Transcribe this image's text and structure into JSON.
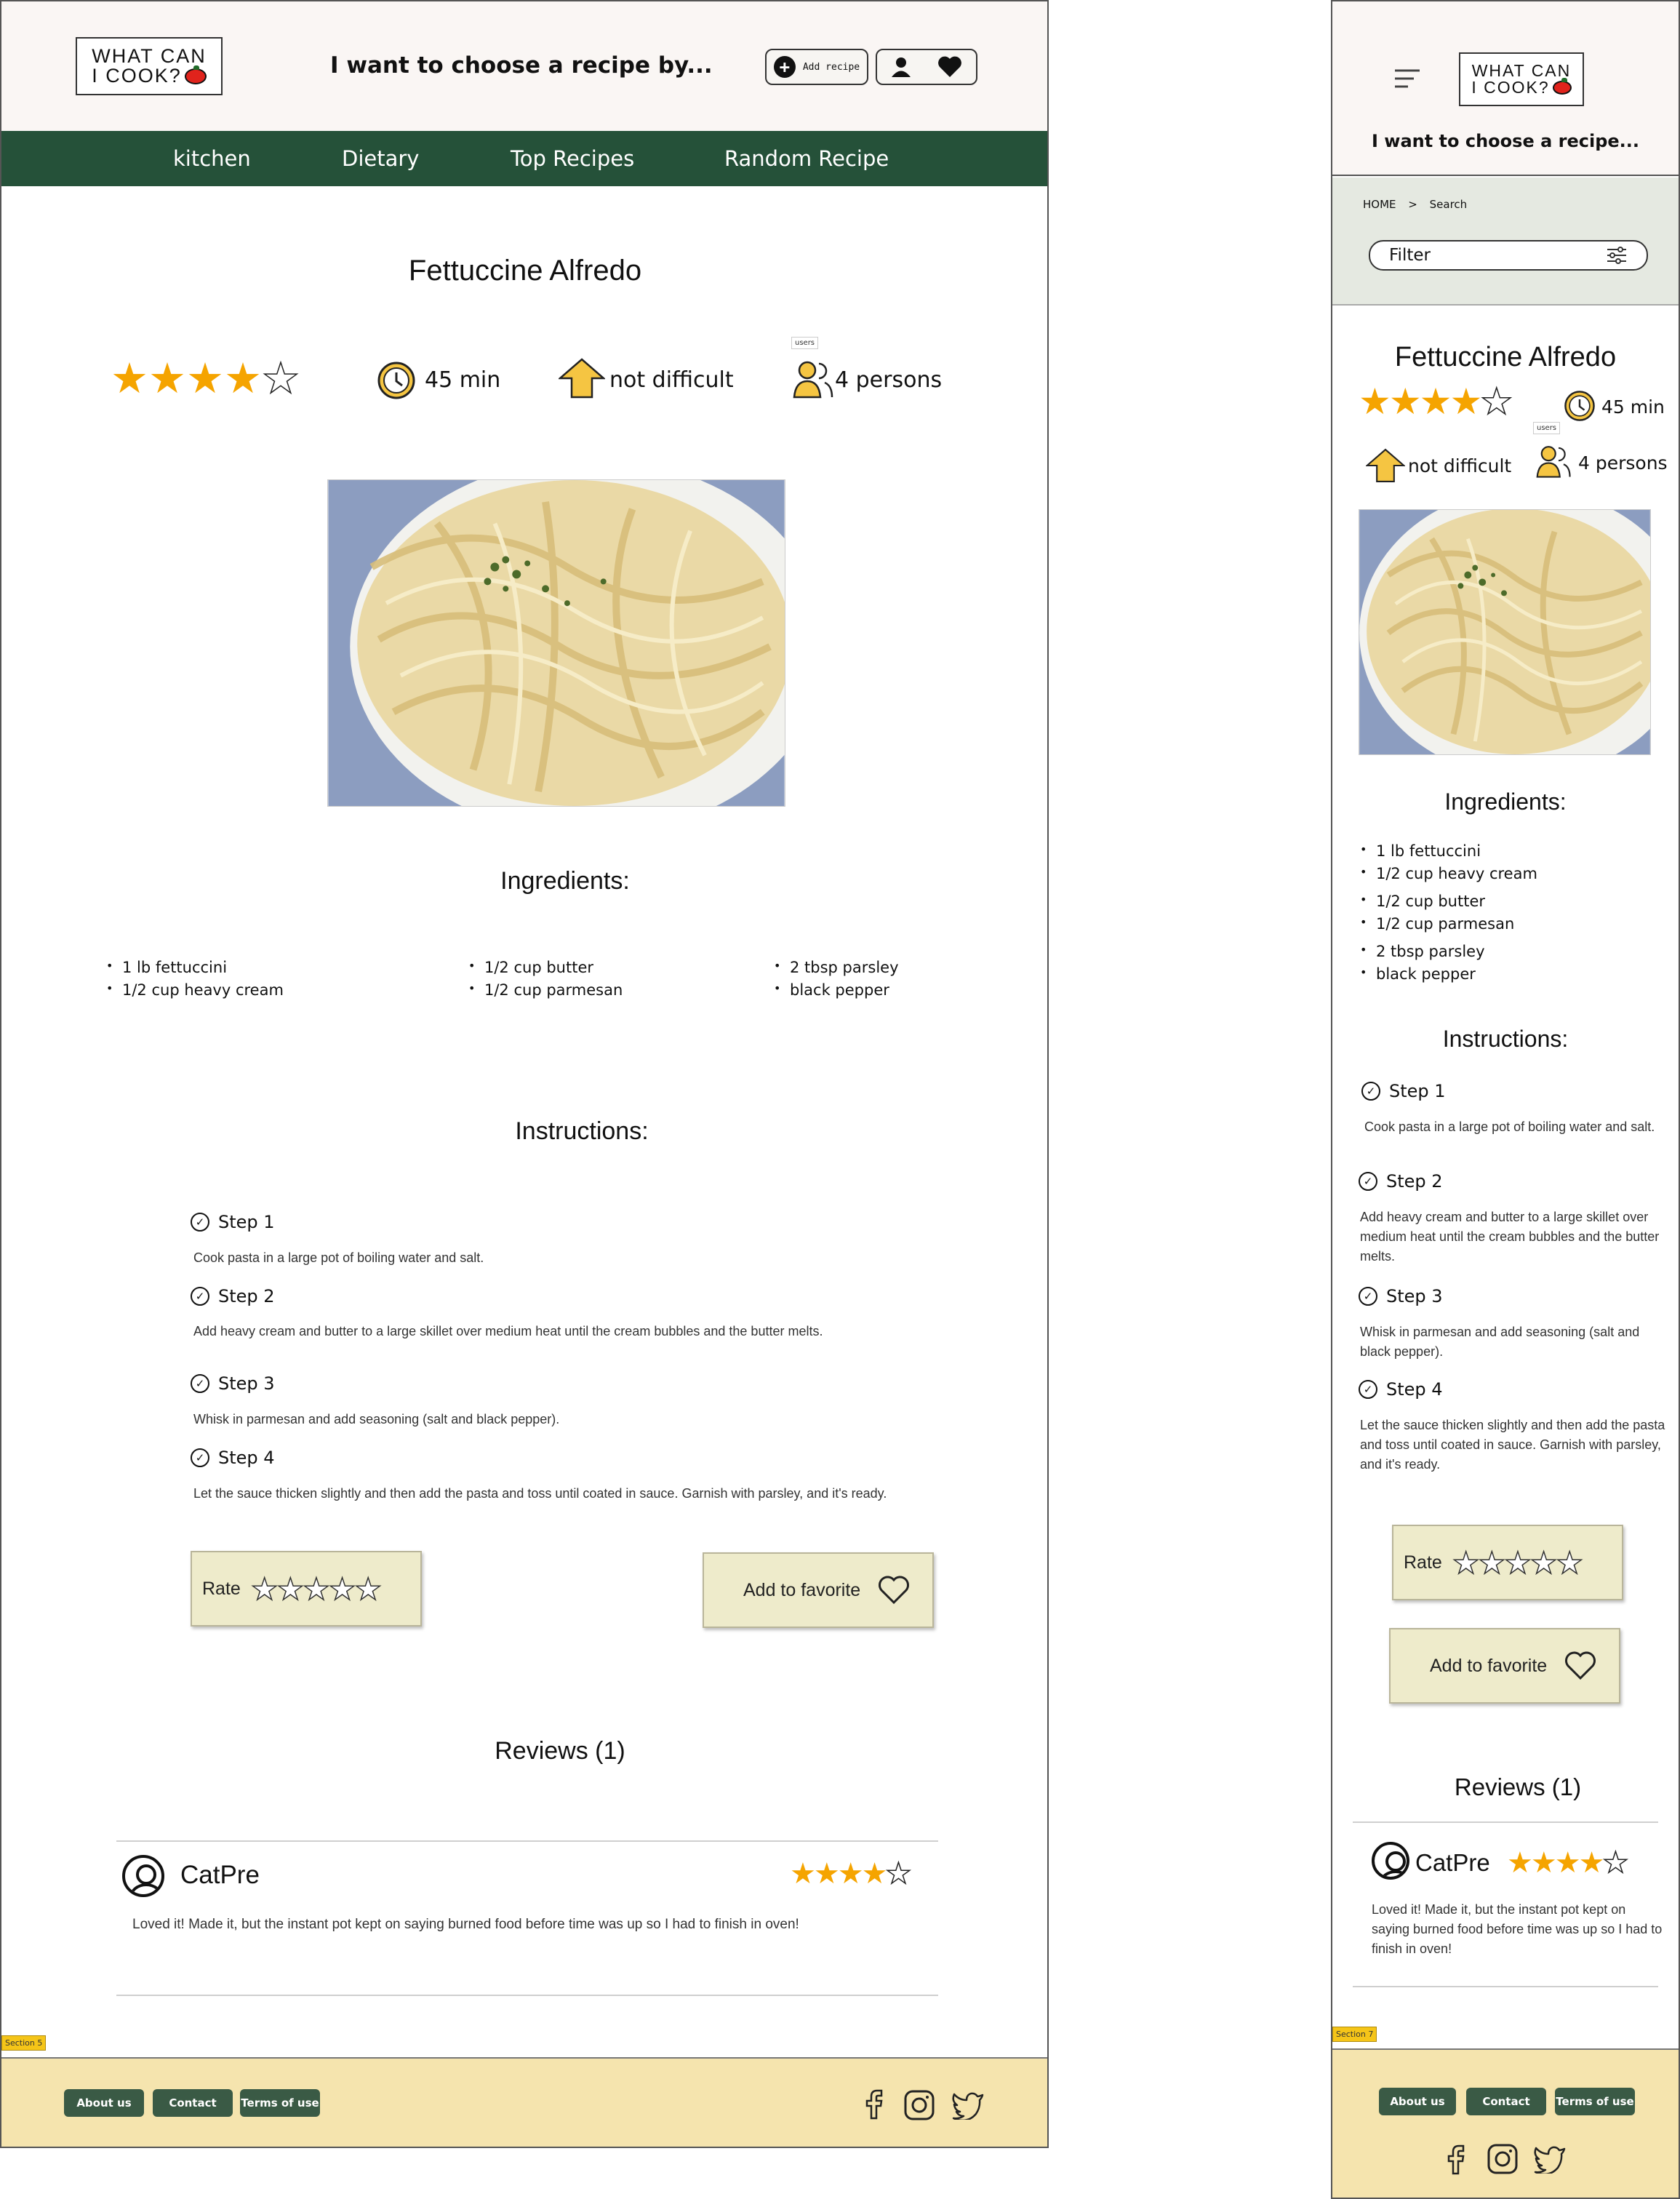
{
  "logo": {
    "line1": "WHAT CAN",
    "line2": "I COOK?"
  },
  "header": {
    "choose_desktop": "I want to choose a recipe by...",
    "choose_mobile": "I want to choose a recipe...",
    "add_recipe": "Add recipe"
  },
  "nav": [
    "kitchen",
    "Dietary",
    "Top Recipes",
    "Random Recipe"
  ],
  "breadcrumb": {
    "home": "HOME",
    "sep": ">",
    "current": "Search"
  },
  "filter": {
    "label": "Filter"
  },
  "recipe": {
    "title": "Fettuccine Alfredo",
    "rating": 4,
    "rating_max": 5,
    "time": "45 min",
    "difficulty": "not difficult",
    "persons": "4 persons",
    "users_tag": "users"
  },
  "ingredients": {
    "heading": "Ingredients:",
    "items": [
      "1 lb fettuccini",
      "1/2 cup heavy cream",
      "1/2 cup butter",
      "1/2 cup parmesan",
      "2 tbsp parsley",
      "black pepper"
    ]
  },
  "instructions": {
    "heading": "Instructions:",
    "steps": [
      {
        "title": "Step 1",
        "desc": "Cook pasta in a large pot of boiling water and salt."
      },
      {
        "title": "Step 2",
        "desc": "Add heavy cream and butter to a large skillet over medium heat until the cream bubbles and the butter melts."
      },
      {
        "title": "Step 3",
        "desc": "Whisk in parmesan and add seasoning (salt and black pepper)."
      },
      {
        "title": "Step 4",
        "desc": "Let the sauce thicken slightly and then add the pasta and toss until coated in sauce. Garnish with parsley, and it's ready."
      }
    ]
  },
  "actions": {
    "rate": "Rate",
    "favorite": "Add to favorite"
  },
  "reviews": {
    "heading": "Reviews (1)",
    "items": [
      {
        "user": "CatPre",
        "rating": 4,
        "text": "Loved it! Made it, but the instant pot kept on saying burned food before time was up so I had to finish in oven!"
      }
    ]
  },
  "section_tags": {
    "desktop": "Section 5",
    "mobile": "Section 7"
  },
  "footer": {
    "about": "About us",
    "contact": "Contact",
    "terms": "Terms of use"
  },
  "colors": {
    "nav": "#255139",
    "star": "#f5a400",
    "footer": "#f5e4ae",
    "button": "#eeebcb",
    "header": "#faf6f4",
    "filter_band": "#e5e9e1"
  }
}
